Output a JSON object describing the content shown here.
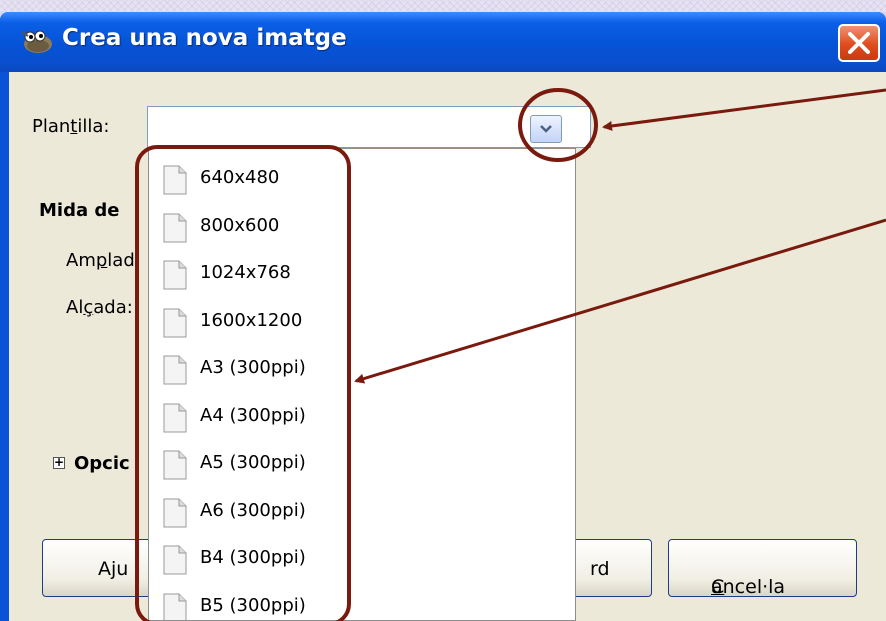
{
  "window": {
    "title": "Crea una nova imatge",
    "icon": "gimp-wilber-icon"
  },
  "form": {
    "template_label_pre": "Plan",
    "template_label_mnemonic": "t",
    "template_label_post": "illa:",
    "template_value": "",
    "size_heading": "Mida de",
    "width_label_pre": "Am",
    "width_label_mnemonic": "p",
    "width_label_post": "lad",
    "height_label_pre": "Al",
    "height_label_mnemonic": "ç",
    "height_label_post": "ada:",
    "advanced_label": "Opcic"
  },
  "buttons": {
    "help_partial": "Aju",
    "ok_partial": "rd",
    "cancel_mnemonic": "C",
    "cancel_rest": "ancel·la"
  },
  "dropdown": {
    "items": [
      {
        "label": "640x480"
      },
      {
        "label": "800x600"
      },
      {
        "label": "1024x768"
      },
      {
        "label": "1600x1200"
      },
      {
        "label": "A3 (300ppi)"
      },
      {
        "label": "A4 (300ppi)"
      },
      {
        "label": "A5 (300ppi)"
      },
      {
        "label": "A6 (300ppi)"
      },
      {
        "label": "B4 (300ppi)"
      },
      {
        "label": "B5 (300ppi)"
      }
    ],
    "item_icon": "document-file-icon"
  },
  "annotations": {
    "color": "#7a1a0e"
  },
  "colors": {
    "titlebar": "#0653d6",
    "client_bg": "#ece9d8",
    "close_button": "#df4c1e"
  }
}
